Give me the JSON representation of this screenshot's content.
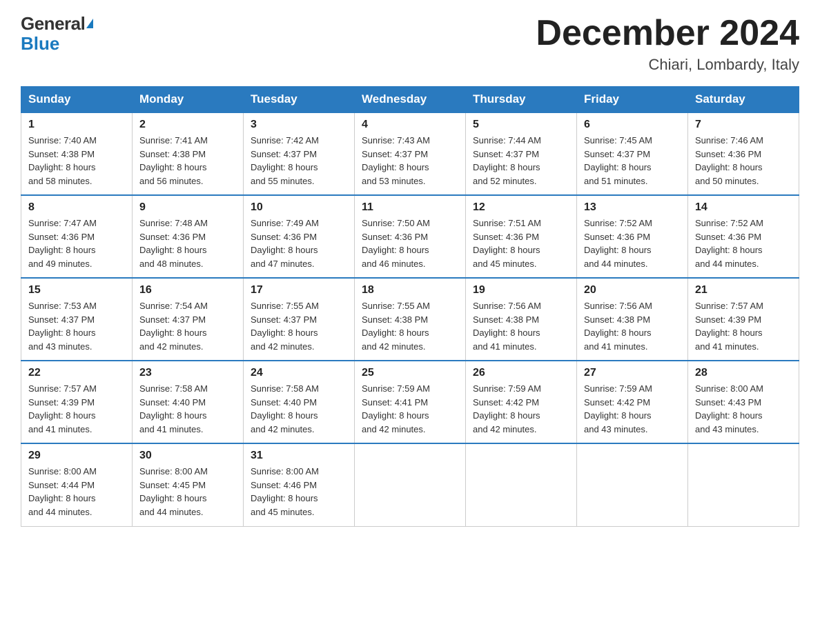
{
  "header": {
    "logo": {
      "general": "General",
      "blue": "Blue",
      "triangle": "▶"
    },
    "month_title": "December 2024",
    "location": "Chiari, Lombardy, Italy"
  },
  "days_of_week": [
    "Sunday",
    "Monday",
    "Tuesday",
    "Wednesday",
    "Thursday",
    "Friday",
    "Saturday"
  ],
  "weeks": [
    [
      {
        "day": "1",
        "sunrise": "7:40 AM",
        "sunset": "4:38 PM",
        "daylight": "8 hours and 58 minutes."
      },
      {
        "day": "2",
        "sunrise": "7:41 AM",
        "sunset": "4:38 PM",
        "daylight": "8 hours and 56 minutes."
      },
      {
        "day": "3",
        "sunrise": "7:42 AM",
        "sunset": "4:37 PM",
        "daylight": "8 hours and 55 minutes."
      },
      {
        "day": "4",
        "sunrise": "7:43 AM",
        "sunset": "4:37 PM",
        "daylight": "8 hours and 53 minutes."
      },
      {
        "day": "5",
        "sunrise": "7:44 AM",
        "sunset": "4:37 PM",
        "daylight": "8 hours and 52 minutes."
      },
      {
        "day": "6",
        "sunrise": "7:45 AM",
        "sunset": "4:37 PM",
        "daylight": "8 hours and 51 minutes."
      },
      {
        "day": "7",
        "sunrise": "7:46 AM",
        "sunset": "4:36 PM",
        "daylight": "8 hours and 50 minutes."
      }
    ],
    [
      {
        "day": "8",
        "sunrise": "7:47 AM",
        "sunset": "4:36 PM",
        "daylight": "8 hours and 49 minutes."
      },
      {
        "day": "9",
        "sunrise": "7:48 AM",
        "sunset": "4:36 PM",
        "daylight": "8 hours and 48 minutes."
      },
      {
        "day": "10",
        "sunrise": "7:49 AM",
        "sunset": "4:36 PM",
        "daylight": "8 hours and 47 minutes."
      },
      {
        "day": "11",
        "sunrise": "7:50 AM",
        "sunset": "4:36 PM",
        "daylight": "8 hours and 46 minutes."
      },
      {
        "day": "12",
        "sunrise": "7:51 AM",
        "sunset": "4:36 PM",
        "daylight": "8 hours and 45 minutes."
      },
      {
        "day": "13",
        "sunrise": "7:52 AM",
        "sunset": "4:36 PM",
        "daylight": "8 hours and 44 minutes."
      },
      {
        "day": "14",
        "sunrise": "7:52 AM",
        "sunset": "4:36 PM",
        "daylight": "8 hours and 44 minutes."
      }
    ],
    [
      {
        "day": "15",
        "sunrise": "7:53 AM",
        "sunset": "4:37 PM",
        "daylight": "8 hours and 43 minutes."
      },
      {
        "day": "16",
        "sunrise": "7:54 AM",
        "sunset": "4:37 PM",
        "daylight": "8 hours and 42 minutes."
      },
      {
        "day": "17",
        "sunrise": "7:55 AM",
        "sunset": "4:37 PM",
        "daylight": "8 hours and 42 minutes."
      },
      {
        "day": "18",
        "sunrise": "7:55 AM",
        "sunset": "4:38 PM",
        "daylight": "8 hours and 42 minutes."
      },
      {
        "day": "19",
        "sunrise": "7:56 AM",
        "sunset": "4:38 PM",
        "daylight": "8 hours and 41 minutes."
      },
      {
        "day": "20",
        "sunrise": "7:56 AM",
        "sunset": "4:38 PM",
        "daylight": "8 hours and 41 minutes."
      },
      {
        "day": "21",
        "sunrise": "7:57 AM",
        "sunset": "4:39 PM",
        "daylight": "8 hours and 41 minutes."
      }
    ],
    [
      {
        "day": "22",
        "sunrise": "7:57 AM",
        "sunset": "4:39 PM",
        "daylight": "8 hours and 41 minutes."
      },
      {
        "day": "23",
        "sunrise": "7:58 AM",
        "sunset": "4:40 PM",
        "daylight": "8 hours and 41 minutes."
      },
      {
        "day": "24",
        "sunrise": "7:58 AM",
        "sunset": "4:40 PM",
        "daylight": "8 hours and 42 minutes."
      },
      {
        "day": "25",
        "sunrise": "7:59 AM",
        "sunset": "4:41 PM",
        "daylight": "8 hours and 42 minutes."
      },
      {
        "day": "26",
        "sunrise": "7:59 AM",
        "sunset": "4:42 PM",
        "daylight": "8 hours and 42 minutes."
      },
      {
        "day": "27",
        "sunrise": "7:59 AM",
        "sunset": "4:42 PM",
        "daylight": "8 hours and 43 minutes."
      },
      {
        "day": "28",
        "sunrise": "8:00 AM",
        "sunset": "4:43 PM",
        "daylight": "8 hours and 43 minutes."
      }
    ],
    [
      {
        "day": "29",
        "sunrise": "8:00 AM",
        "sunset": "4:44 PM",
        "daylight": "8 hours and 44 minutes."
      },
      {
        "day": "30",
        "sunrise": "8:00 AM",
        "sunset": "4:45 PM",
        "daylight": "8 hours and 44 minutes."
      },
      {
        "day": "31",
        "sunrise": "8:00 AM",
        "sunset": "4:46 PM",
        "daylight": "8 hours and 45 minutes."
      },
      null,
      null,
      null,
      null
    ]
  ],
  "labels": {
    "sunrise": "Sunrise:",
    "sunset": "Sunset:",
    "daylight": "Daylight:"
  }
}
